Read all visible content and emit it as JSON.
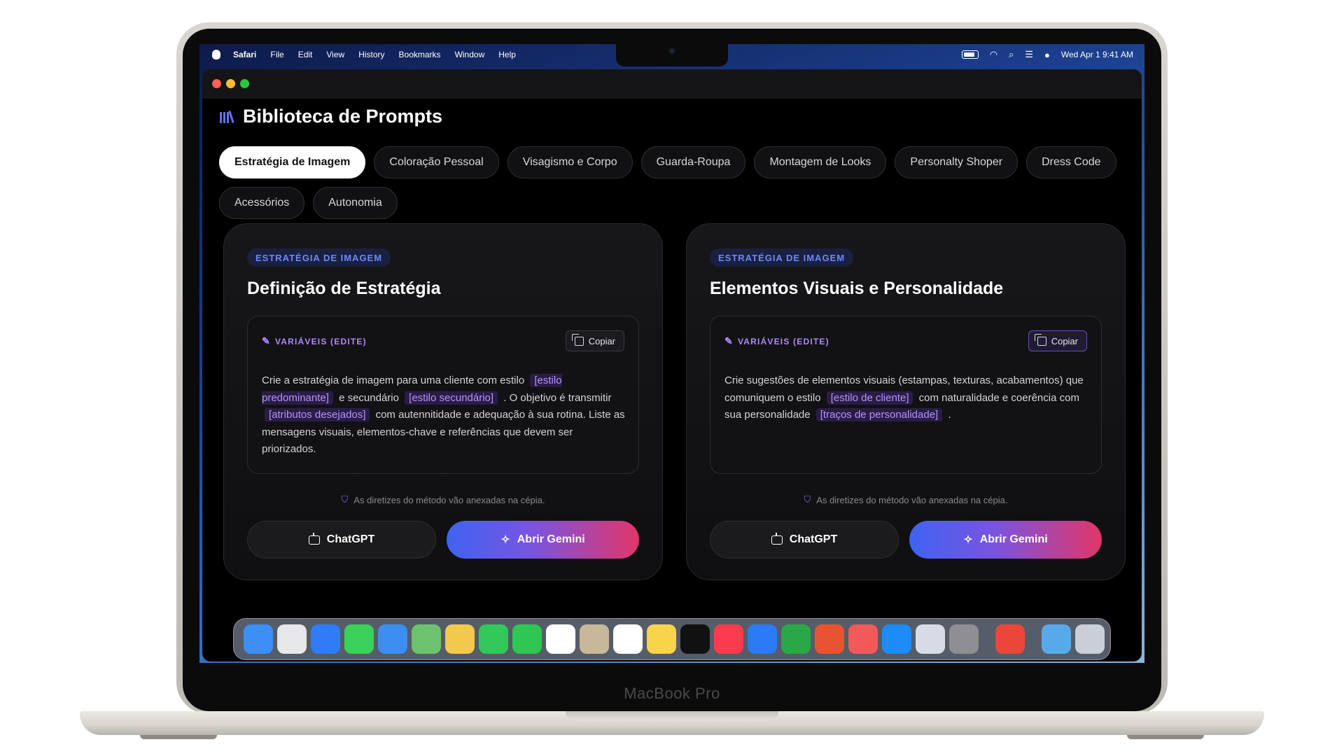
{
  "device_label": "MacBook Pro",
  "menubar": {
    "app": "Safari",
    "items": [
      "File",
      "Edit",
      "View",
      "History",
      "Bookmarks",
      "Window",
      "Help"
    ],
    "datetime": "Wed Apr 1  9:41 AM"
  },
  "app": {
    "title": "Biblioteca de Prompts",
    "tabs": [
      {
        "label": "Estratégia de Imagem",
        "active": true
      },
      {
        "label": "Coloração Pessoal"
      },
      {
        "label": "Visagismo e Corpo"
      },
      {
        "label": "Guarda-Roupa"
      },
      {
        "label": "Montagem de Looks"
      },
      {
        "label": "Personalty Shoper"
      },
      {
        "label": "Dress Code"
      },
      {
        "label": "Acessórios"
      },
      {
        "label": "Autonomia"
      }
    ],
    "cards": [
      {
        "badge": "ESTRATÉGIA DE IMAGEM",
        "title": "Definição de Estratégia",
        "vars_label": "VARIÁVEIS (EDITE)",
        "copy": "Copiar",
        "prompt": {
          "t1": "Crie a estratégia de imagem para uma cliente com estilo",
          "v1": "[estilo predominante]",
          "t2": "e secundário",
          "v2": "[estilo secundário]",
          "t3": ". O objetivo é transmitir",
          "v3": "[atributos desejados]",
          "t4": "com autennitidade e adequação à sua rotina. Liste as mensagens visuais, elementos-chave e referências que devem ser priorizados."
        },
        "note": "As diretizes do método vão anexadas na cépia.",
        "btn_chatgpt": "ChatGPT",
        "btn_gemini": "Abrir Gemini"
      },
      {
        "badge": "ESTRATÉGIA DE IMAGEM",
        "title": "Elementos Visuais e Personalidade",
        "vars_label": "VARIÁVEIS (EDITE)",
        "copy": "Copiar",
        "prompt": {
          "t1": "Crie sugestões de elementos visuais (estampas, texturas, acabamentos) que comuniquem o estilo",
          "v1": "[estilo de cliente]",
          "t2": "com naturalidade e coerência com sua personalidade",
          "v2": "[traços de personalidade]",
          "t3": "."
        },
        "note": "As diretizes do método vão anexadas na cépia.",
        "btn_chatgpt": "ChatGPT",
        "btn_gemini": "Abrir Gemini"
      }
    ]
  },
  "dock": {
    "apps": [
      {
        "name": "finder-icon",
        "color": "#3d8ef5"
      },
      {
        "name": "launchpad-icon",
        "color": "#e7e7ea"
      },
      {
        "name": "safari-icon",
        "color": "#2f7cf6"
      },
      {
        "name": "messages-icon",
        "color": "#3ad05a"
      },
      {
        "name": "mail-icon",
        "color": "#3a8ff0"
      },
      {
        "name": "maps-icon",
        "color": "#6cc26d"
      },
      {
        "name": "photos-icon",
        "color": "#f2c94c"
      },
      {
        "name": "facetime-icon",
        "color": "#34c759"
      },
      {
        "name": "phone-icon",
        "color": "#30c653"
      },
      {
        "name": "calendar-icon",
        "color": "#ffffff"
      },
      {
        "name": "contacts-icon",
        "color": "#c9b79a"
      },
      {
        "name": "reminders-icon",
        "color": "#ffffff"
      },
      {
        "name": "notes-icon",
        "color": "#f7d44a"
      },
      {
        "name": "tv-icon",
        "color": "#111111"
      },
      {
        "name": "music-icon",
        "color": "#fb3c4e"
      },
      {
        "name": "keynote-icon",
        "color": "#2a7bf5"
      },
      {
        "name": "numbers-icon",
        "color": "#2aa845"
      },
      {
        "name": "pages-icon",
        "color": "#e8542f"
      },
      {
        "name": "rocket-icon",
        "color": "#f25a5a"
      },
      {
        "name": "appstore-icon",
        "color": "#1e8cf7"
      },
      {
        "name": "simulator-icon",
        "color": "#d7dbe6"
      },
      {
        "name": "settings-icon",
        "color": "#8e8e93"
      },
      {
        "name": "sep"
      },
      {
        "name": "app-red-icon",
        "color": "#e9473a"
      },
      {
        "name": "sep"
      },
      {
        "name": "downloads-folder-icon",
        "color": "#58a9ea"
      },
      {
        "name": "trash-icon",
        "color": "#c9ced8"
      }
    ]
  }
}
